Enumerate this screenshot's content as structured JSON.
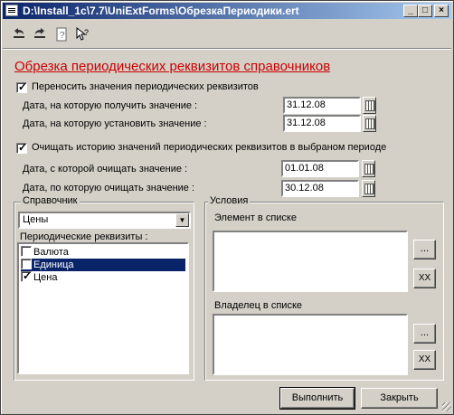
{
  "window": {
    "title": "D:\\Install_1c\\7.7\\UniExtForms\\ОбрезкаПериодики.ert"
  },
  "toolbar": {
    "icons": [
      "undo-icon",
      "redo-icon",
      "help-icon",
      "context-help-icon"
    ]
  },
  "header": {
    "title": "Обрезка периодических реквизитов справочников"
  },
  "transfer": {
    "checkbox_label": "Переносить значения периодических реквизитов",
    "checked": true,
    "get_date_label": "Дата, на которую получить значение :",
    "get_date_value": "31.12.08",
    "set_date_label": "Дата, на которую установить значение :",
    "set_date_value": "31.12.08"
  },
  "clear": {
    "checkbox_label": "Очищать историю значений периодических реквизитов в выбраном периоде",
    "checked": true,
    "from_label": "Дата, с которой очищать значение :",
    "from_value": "01.01.08",
    "to_label": "Дата, по которую очищать значение :",
    "to_value": "30.12.08"
  },
  "catalog": {
    "group_label": "Справочник",
    "selected": "Цены",
    "attrs_label": "Периодические реквизиты :",
    "attrs": [
      {
        "label": "Валюта",
        "checked": false,
        "selected": false
      },
      {
        "label": "Единица",
        "checked": false,
        "selected": true
      },
      {
        "label": "Цена",
        "checked": true,
        "selected": false
      }
    ]
  },
  "conditions": {
    "group_label": "Условия",
    "element_label": "Элемент в списке",
    "owner_label": "Владелец в списке",
    "browse_label": "...",
    "clear_label": "XX"
  },
  "buttons": {
    "run": "Выполнить",
    "close": "Закрыть"
  }
}
